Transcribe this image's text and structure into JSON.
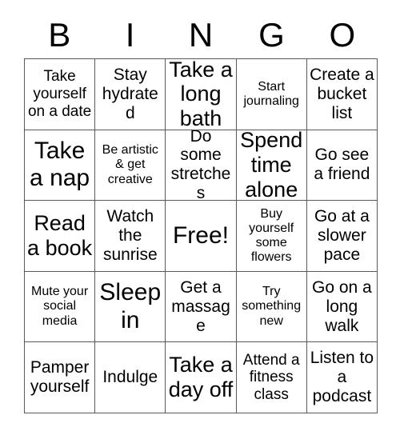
{
  "card": {
    "title": "BINGO",
    "header_letters": [
      "B",
      "I",
      "N",
      "G",
      "O"
    ],
    "grid_size": "5x5",
    "free_space": "Free!",
    "colors": {
      "background": "#ffffff",
      "text": "#000000",
      "border": "#5a5a5a"
    },
    "rows": [
      [
        {
          "text": "Take yourself on a date",
          "size": "md"
        },
        {
          "text": "Stay hydrated",
          "size": "lg"
        },
        {
          "text": "Take a long bath",
          "size": "xl"
        },
        {
          "text": "Start journaling",
          "size": "sm"
        },
        {
          "text": "Create a bucket list",
          "size": "lg"
        }
      ],
      [
        {
          "text": "Take a nap",
          "size": "xxl"
        },
        {
          "text": "Be artistic & get creative",
          "size": "sm"
        },
        {
          "text": "Do some stretches",
          "size": "lg"
        },
        {
          "text": "Spend time alone",
          "size": "xl"
        },
        {
          "text": "Go see a friend",
          "size": "lg"
        }
      ],
      [
        {
          "text": "Read a book",
          "size": "xl"
        },
        {
          "text": "Watch the sunrise",
          "size": "lg"
        },
        {
          "text": "Free!",
          "size": "xxl"
        },
        {
          "text": "Buy yourself some flowers",
          "size": "sm"
        },
        {
          "text": "Go at a slower pace",
          "size": "lg"
        }
      ],
      [
        {
          "text": "Mute your social media",
          "size": "sm"
        },
        {
          "text": "Sleep in",
          "size": "xxl"
        },
        {
          "text": "Get a massage",
          "size": "lg"
        },
        {
          "text": "Try something new",
          "size": "sm"
        },
        {
          "text": "Go on a long walk",
          "size": "lg"
        }
      ],
      [
        {
          "text": "Pamper yourself",
          "size": "lg"
        },
        {
          "text": "Indulge",
          "size": "lg"
        },
        {
          "text": "Take a day off",
          "size": "xl"
        },
        {
          "text": "Attend a fitness class",
          "size": "md"
        },
        {
          "text": "Listen to a podcast",
          "size": "lg"
        }
      ]
    ]
  }
}
